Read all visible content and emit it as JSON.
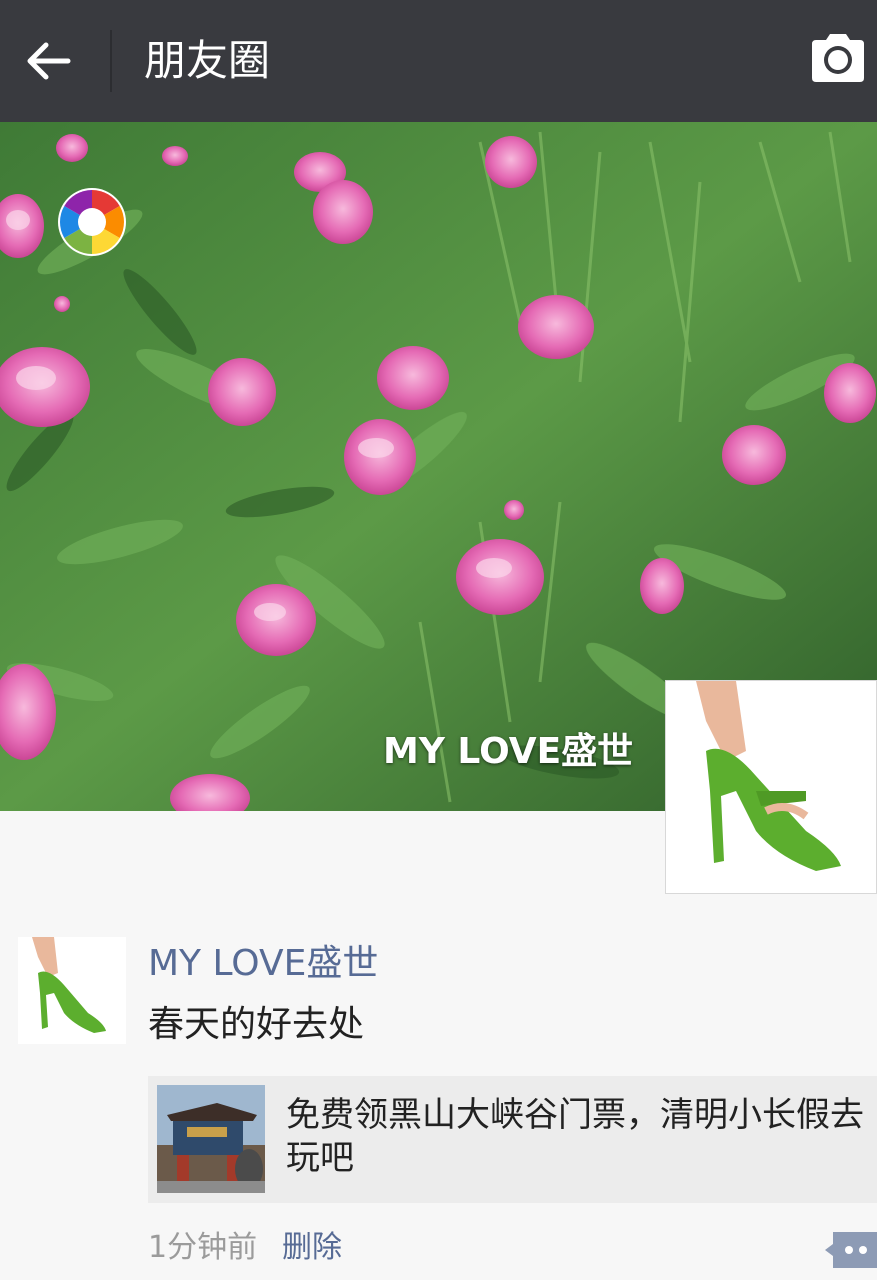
{
  "header": {
    "back_icon": "arrow-left-icon",
    "title": "朋友圈",
    "camera_icon": "camera-icon"
  },
  "cover": {
    "owner_name": "MY LOVE盛世",
    "badge_icon": "camera-shutter-aperture-icon"
  },
  "post": {
    "author": "MY LOVE盛世",
    "text": "春天的好去处",
    "link": {
      "title": "免费领黑山大峡谷门票，清明小长假去玩吧"
    },
    "time": "1分钟前",
    "delete_label": "删除",
    "comment_icon": "more-dots-icon"
  },
  "colors": {
    "topbar": "#393a3f",
    "link_blue": "#576b95",
    "page_bg": "#f7f7f7"
  }
}
